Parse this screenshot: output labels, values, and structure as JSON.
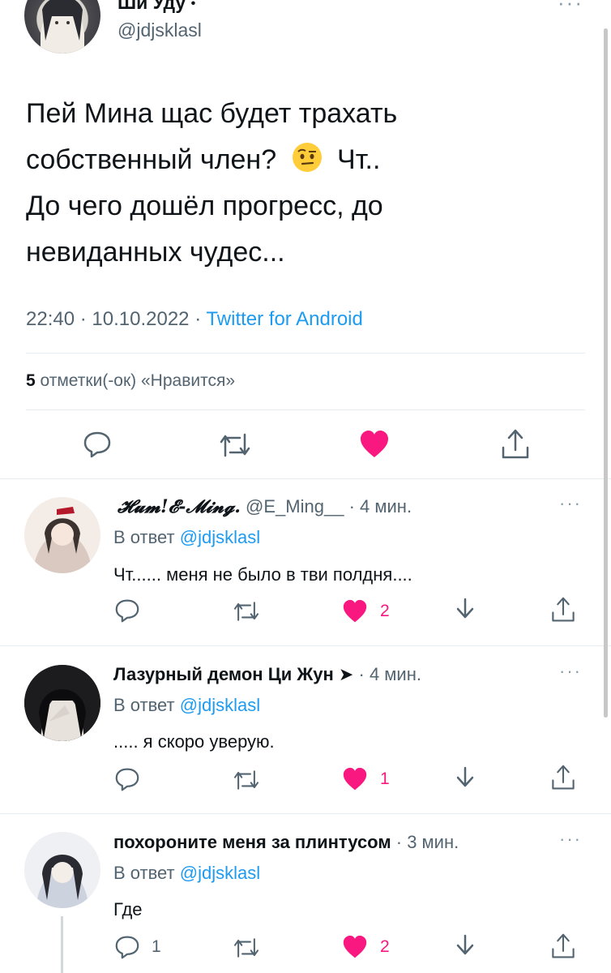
{
  "main_tweet": {
    "author_name": "Ши Уду",
    "author_verified_dot": "•",
    "handle": "@jdjsklasl",
    "text_line1": "Пей Мина щас будет трахать",
    "text_line2a": "собственный член?",
    "text_line2_emoji": "🤨",
    "text_line2b": "Чт..",
    "text_line3": "До чего дошёл прогресс, до",
    "text_line4": "невиданных чудес...",
    "time": "22:40",
    "date": "10.10.2022",
    "separator": "·",
    "client": "Twitter for Android",
    "likes_count": "5",
    "likes_label": "отметки(-ок) «Нравится»",
    "more": "···"
  },
  "replies": [
    {
      "name": "𝓗𝓾𝓶!𝓔-𝓜𝓲𝓷𝓰.",
      "handle": "@E_Ming__",
      "time": "4 мин.",
      "reply_prefix": "В ответ",
      "reply_to": "@jdjsklasl",
      "text": "Чт...... меня не было в тви полдня....",
      "likes": "2",
      "replies_count": "",
      "more": "···"
    },
    {
      "name": "Лазурный демон Ци Жун ➤",
      "handle": "",
      "time": "4 мин.",
      "reply_prefix": "В ответ",
      "reply_to": "@jdjsklasl",
      "text": "..... я скоро уверую.",
      "likes": "1",
      "replies_count": "",
      "more": "···"
    },
    {
      "name": "похороните меня за плинтусом",
      "handle": "",
      "time": "3 мин.",
      "reply_prefix": "В ответ",
      "reply_to": "@jdjsklasl",
      "text": "Где",
      "likes": "2",
      "replies_count": "1",
      "more": "···"
    }
  ],
  "colors": {
    "like_active": "#f91880",
    "link": "#1d9bf0",
    "muted": "#536471",
    "icon": "#536471"
  },
  "icons": [
    "reply-icon",
    "retweet-icon",
    "heart-icon",
    "share-icon",
    "bookmark-icon",
    "more-icon"
  ]
}
